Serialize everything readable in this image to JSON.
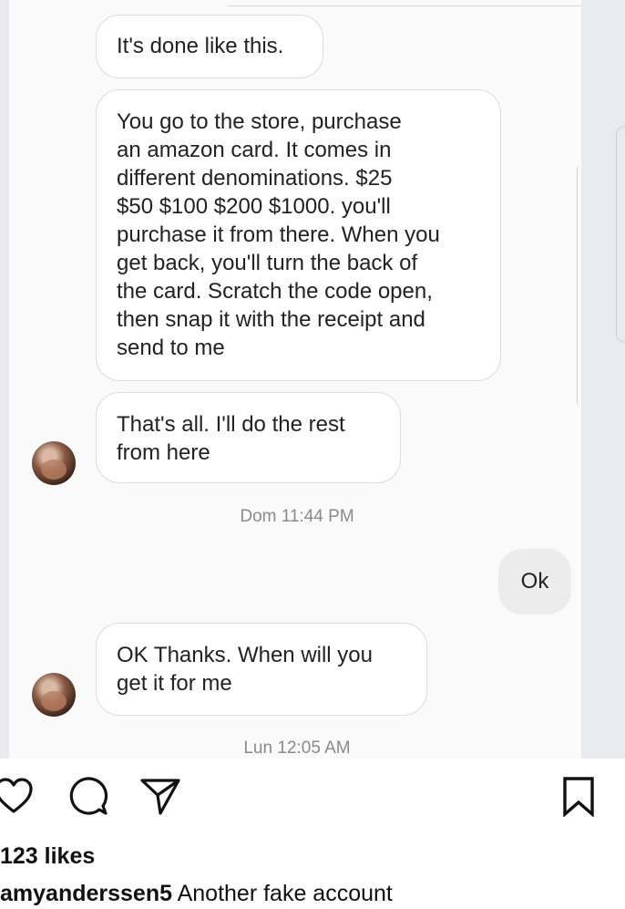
{
  "chat": {
    "messages": [
      {
        "text": "It's done like this."
      },
      {
        "text": "You go to the store,  purchase\nan amazon card.  It comes in\ndifferent denominations. $25\n$50 $100 $200 $1000. you'll\npurchase it from there. When you\nget back,  you'll turn the back of\nthe card.  Scratch the code open,\nthen snap it with the receipt and\nsend to me"
      },
      {
        "text": "That's all.  I'll do the rest\nfrom here"
      },
      {
        "text": "Ok"
      },
      {
        "text": "OK Thanks.  When will you\nget it for me"
      }
    ],
    "timestamps": [
      "Dom 11:44 PM",
      "Lun 12:05 AM"
    ]
  },
  "post": {
    "likes": "123 likes",
    "username": "amyanderssen5",
    "caption": "Another fake account"
  },
  "icons": [
    "heart-icon",
    "comment-icon",
    "share-icon",
    "bookmark-icon"
  ]
}
